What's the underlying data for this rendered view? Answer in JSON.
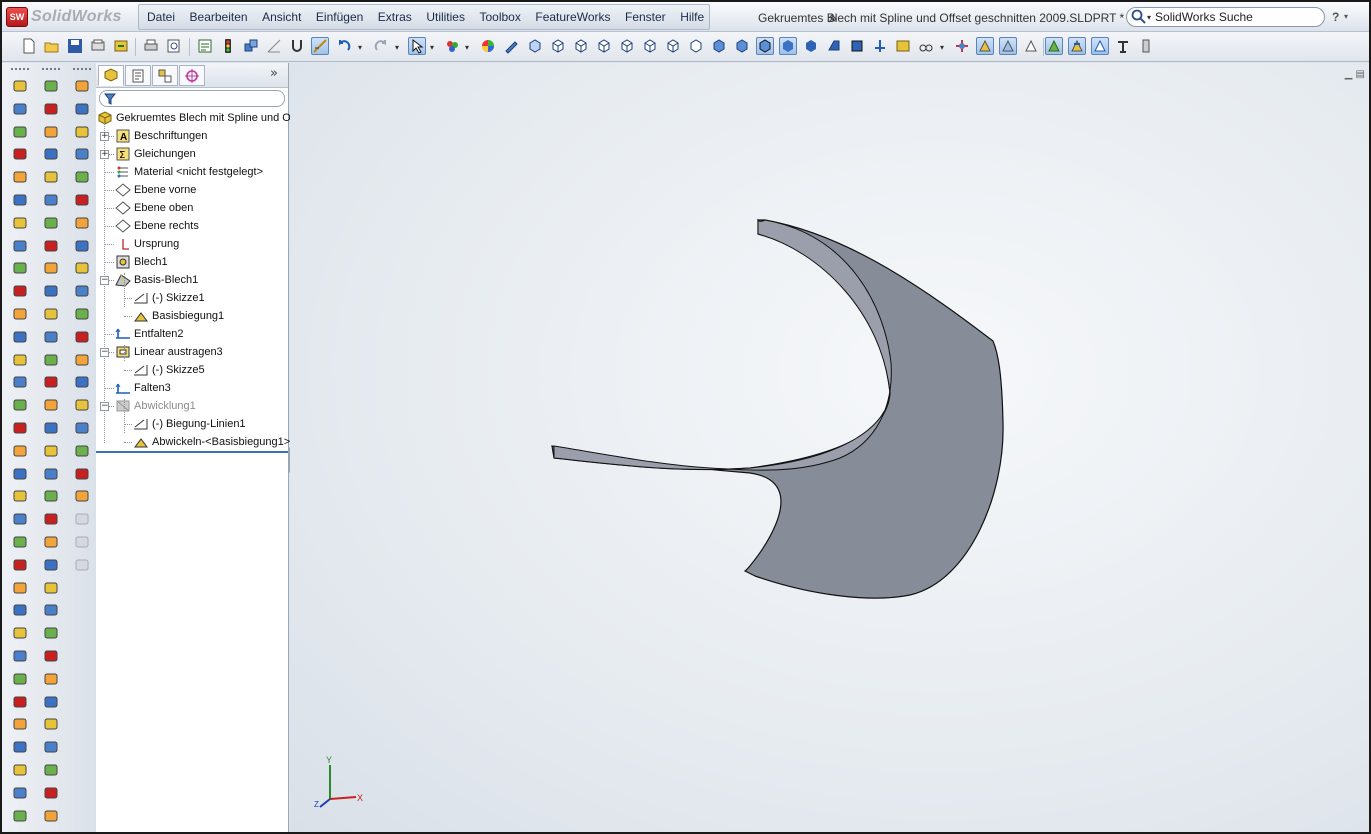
{
  "app": {
    "logo_badge": "SW",
    "logo_text": "SolidWorks"
  },
  "menu": [
    "Datei",
    "Bearbeiten",
    "Ansicht",
    "Einfügen",
    "Extras",
    "Utilities",
    "Toolbox",
    "FeatureWorks",
    "Fenster",
    "Hilfe"
  ],
  "document_title": "Gekruemtes Blech mit Spline und Offset geschnitten 2009.SLDPRT *",
  "search": {
    "placeholder": "SolidWorks Suche",
    "icon": "magnifier-icon"
  },
  "help": {
    "label": "?",
    "arrow": "▾"
  },
  "toolbar_icons": [
    "new-document",
    "open",
    "save",
    "print-preview",
    "rebuild",
    "print",
    "options",
    "properties",
    "traffic-light",
    "assembly",
    "sketch",
    "magnet",
    "smart-dimension",
    "undo",
    "redo",
    "select",
    "appearance",
    "color-wheel",
    "pen",
    "isometric",
    "front",
    "back",
    "left",
    "right",
    "top",
    "bottom",
    "normal-to",
    "shaded-with-edges",
    "shaded",
    "hidden-lines",
    "wireframe",
    "section-view",
    "view-axis",
    "display-pane",
    "orientation",
    "hide-show",
    "rotate",
    "pan",
    "zoom-fit",
    "zoom-area",
    "sheetmetal",
    "lights",
    "cameras"
  ],
  "feature_manager": {
    "tabs": [
      "feature-manager-tab",
      "property-manager-tab",
      "configuration-manager-tab",
      "dimxpert-tab"
    ],
    "expand_label": "»",
    "root": "Gekruemtes Blech mit Spline und Of",
    "items": [
      {
        "label": "Beschriftungen",
        "icon": "annotations-icon",
        "expander": "+"
      },
      {
        "label": "Gleichungen",
        "icon": "equations-icon",
        "expander": "+"
      },
      {
        "label": "Material <nicht festgelegt>",
        "icon": "material-icon",
        "expander": ""
      },
      {
        "label": "Ebene vorne",
        "icon": "plane-icon",
        "expander": ""
      },
      {
        "label": "Ebene oben",
        "icon": "plane-icon",
        "expander": ""
      },
      {
        "label": "Ebene rechts",
        "icon": "plane-icon",
        "expander": ""
      },
      {
        "label": "Ursprung",
        "icon": "origin-icon",
        "expander": ""
      },
      {
        "label": "Blech1",
        "icon": "sheetmetal-icon",
        "expander": ""
      },
      {
        "label": "Basis-Blech1",
        "icon": "base-flange-icon",
        "expander": "−"
      },
      {
        "label": "(-) Skizze1",
        "icon": "sketch-icon",
        "expander": ""
      },
      {
        "label": "Basisbiegung1",
        "icon": "bend-icon",
        "expander": ""
      },
      {
        "label": "Entfalten2",
        "icon": "unfold-icon",
        "expander": ""
      },
      {
        "label": "Linear austragen3",
        "icon": "extruded-cut-icon",
        "expander": "−"
      },
      {
        "label": "(-) Skizze5",
        "icon": "sketch-icon",
        "expander": ""
      },
      {
        "label": "Falten3",
        "icon": "fold-icon",
        "expander": ""
      },
      {
        "label": "Abwicklung1",
        "icon": "flat-pattern-icon",
        "expander": "−",
        "suppressed": true
      },
      {
        "label": "(-) Biegung-Linien1",
        "icon": "sketch-icon",
        "expander": ""
      },
      {
        "label": "Abwickeln-<Basisbiegung1>",
        "icon": "bend-icon",
        "expander": ""
      }
    ]
  },
  "triad": {
    "x": "X",
    "y": "Y",
    "z": "Z"
  },
  "colors": {
    "model": "#8a8f9c",
    "model_edge": "#1a1a1a",
    "accent": "#3b6fb6",
    "logo": "#c21f1f"
  }
}
